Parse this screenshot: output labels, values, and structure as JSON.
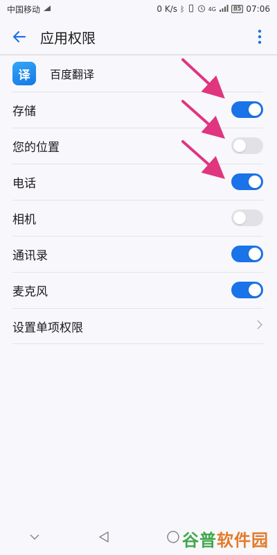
{
  "status": {
    "carrier": "中国移动",
    "net_speed": "0 K/s",
    "battery": "85",
    "time": "07:06",
    "signal": "4G"
  },
  "header": {
    "title": "应用权限"
  },
  "app": {
    "name": "百度翻译",
    "icon_glyph": "译"
  },
  "permissions": [
    {
      "label": "存储",
      "enabled": true
    },
    {
      "label": "您的位置",
      "enabled": false
    },
    {
      "label": "电话",
      "enabled": true
    },
    {
      "label": "相机",
      "enabled": false
    },
    {
      "label": "通讯录",
      "enabled": true
    },
    {
      "label": "麦克风",
      "enabled": true
    }
  ],
  "settings_item": {
    "label": "设置单项权限"
  },
  "watermark": {
    "chars": [
      "谷",
      "普",
      "软",
      "件",
      "园"
    ],
    "colors": [
      "#3fa74a",
      "#3fa74a",
      "#e37b2a",
      "#e37b2a",
      "#e37b2a"
    ]
  },
  "colors": {
    "accent": "#1a73e8",
    "arrow": "#e0357f",
    "toggle_off": "#e2e2e6"
  }
}
